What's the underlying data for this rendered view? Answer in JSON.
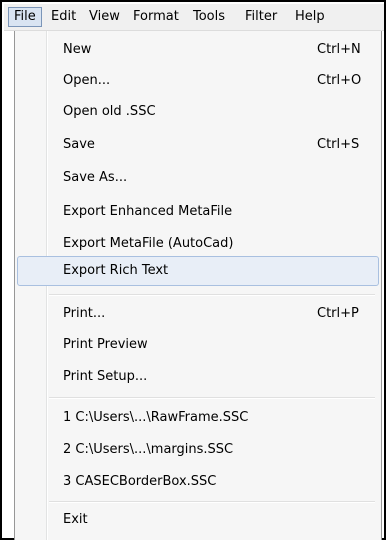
{
  "menubar": {
    "items": [
      {
        "label": "File"
      },
      {
        "label": "Edit"
      },
      {
        "label": "View"
      },
      {
        "label": "Format"
      },
      {
        "label": "Tools"
      },
      {
        "label": "Filter"
      },
      {
        "label": "Help"
      }
    ]
  },
  "file_menu": {
    "new": {
      "label": "New",
      "shortcut": "Ctrl+N"
    },
    "open": {
      "label": "Open...",
      "shortcut": "Ctrl+O"
    },
    "open_old": {
      "label": "Open old .SSC"
    },
    "save": {
      "label": "Save",
      "shortcut": "Ctrl+S"
    },
    "save_as": {
      "label": "Save As..."
    },
    "export_emf": {
      "label": "Export Enhanced MetaFile"
    },
    "export_wmf": {
      "label": "Export MetaFile (AutoCad)"
    },
    "export_rtf": {
      "label": "Export Rich Text"
    },
    "print": {
      "label": "Print...",
      "shortcut": "Ctrl+P"
    },
    "print_preview": {
      "label": "Print Preview"
    },
    "print_setup": {
      "label": "Print Setup..."
    },
    "recent1": {
      "label": "1 C:\\Users\\...\\RawFrame.SSC"
    },
    "recent2": {
      "label": "2 C:\\Users\\...\\margins.SSC"
    },
    "recent3": {
      "label": "3 CASECBorderBox.SSC"
    },
    "exit": {
      "label": "Exit"
    }
  }
}
